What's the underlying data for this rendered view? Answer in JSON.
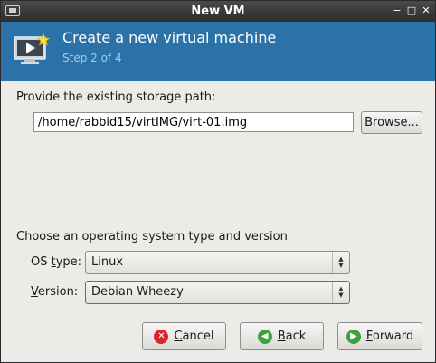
{
  "window": {
    "title": "New VM"
  },
  "banner": {
    "title": "Create a new virtual machine",
    "step": "Step 2 of 4"
  },
  "storage": {
    "label": "Provide the existing storage path:",
    "path_value": "/home/rabbid15/virtIMG/virt-01.img",
    "browse_label": "Browse..."
  },
  "os": {
    "section_label": "Choose an operating system type and version",
    "type_label_prefix": "OS ",
    "type_label_mnemonic": "t",
    "type_label_suffix": "ype:",
    "type_value": "Linux",
    "version_label_mnemonic": "V",
    "version_label_suffix": "ersion:",
    "version_value": "Debian Wheezy"
  },
  "buttons": {
    "cancel_mnemonic": "C",
    "cancel_rest": "ancel",
    "back_mnemonic": "B",
    "back_rest": "ack",
    "forward_mnemonic": "F",
    "forward_rest": "orward"
  },
  "colors": {
    "banner": "#2a72a8",
    "cancel_icon": "#d8262a",
    "nav_icon": "#3aa43a"
  }
}
